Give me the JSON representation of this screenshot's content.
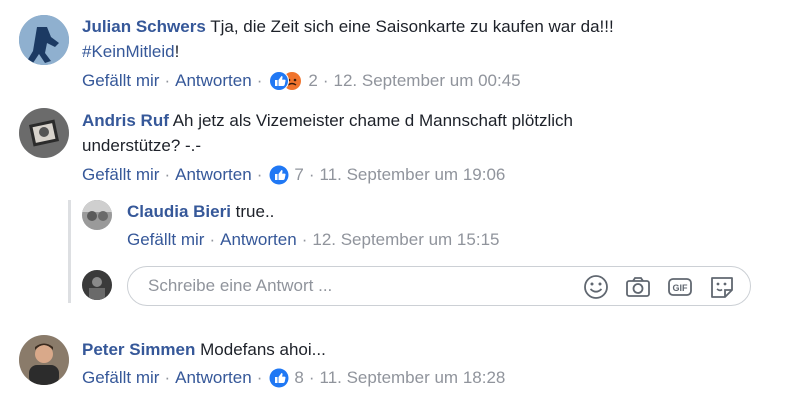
{
  "comments": [
    {
      "author": "Julian Schwers",
      "text": "Tja, die Zeit sich eine Saisonkarte zu kaufen war da!!!",
      "hashtag": "#KeinMitleid",
      "hashtag_suffix": "!",
      "like_label": "Gefällt mir",
      "reply_label": "Antworten",
      "reaction_count": "2",
      "timestamp": "12. September um 00:45"
    },
    {
      "author": "Andris Ruf",
      "text_line1": "Ah jetz als Vizemeister chame d Mannschaft plötzlich",
      "text_line2": "understütze? -.-",
      "like_label": "Gefällt mir",
      "reply_label": "Antworten",
      "reaction_count": "7",
      "timestamp": "11. September um 19:06"
    },
    {
      "author": "Claudia Bieri",
      "text": "true..",
      "like_label": "Gefällt mir",
      "reply_label": "Antworten",
      "timestamp": "12. September um 15:15"
    },
    {
      "author": "Peter Simmen",
      "text": "Modefans ahoi...",
      "like_label": "Gefällt mir",
      "reply_label": "Antworten",
      "reaction_count": "8",
      "timestamp": "11. September um 18:28"
    }
  ],
  "reply_box": {
    "placeholder": "Schreibe eine Antwort ...",
    "icons": [
      "emoji-icon",
      "camera-icon",
      "gif-icon",
      "sticker-icon"
    ]
  },
  "colors": {
    "link": "#365899",
    "meta": "#90949c",
    "like_blue": "#2078f4",
    "angry_orange": "#f0742d"
  },
  "separator": "·"
}
